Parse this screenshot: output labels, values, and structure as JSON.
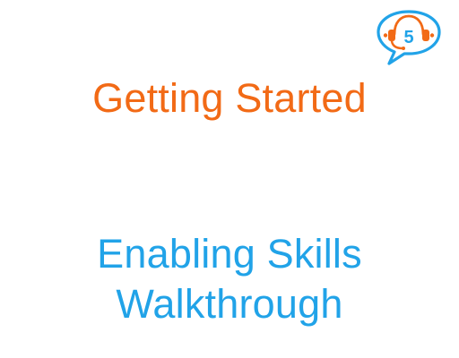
{
  "brand": {
    "icon": "headset-chat-bubble-icon",
    "badge_number": "5"
  },
  "slide": {
    "title": "Getting Started",
    "subtitle_lines": [
      "Enabling Skills",
      "Walkthrough"
    ]
  },
  "colors": {
    "title": "#F26A16",
    "subtitle": "#21A3E8",
    "logo_blue": "#21A3E8",
    "logo_orange": "#F26A16"
  }
}
